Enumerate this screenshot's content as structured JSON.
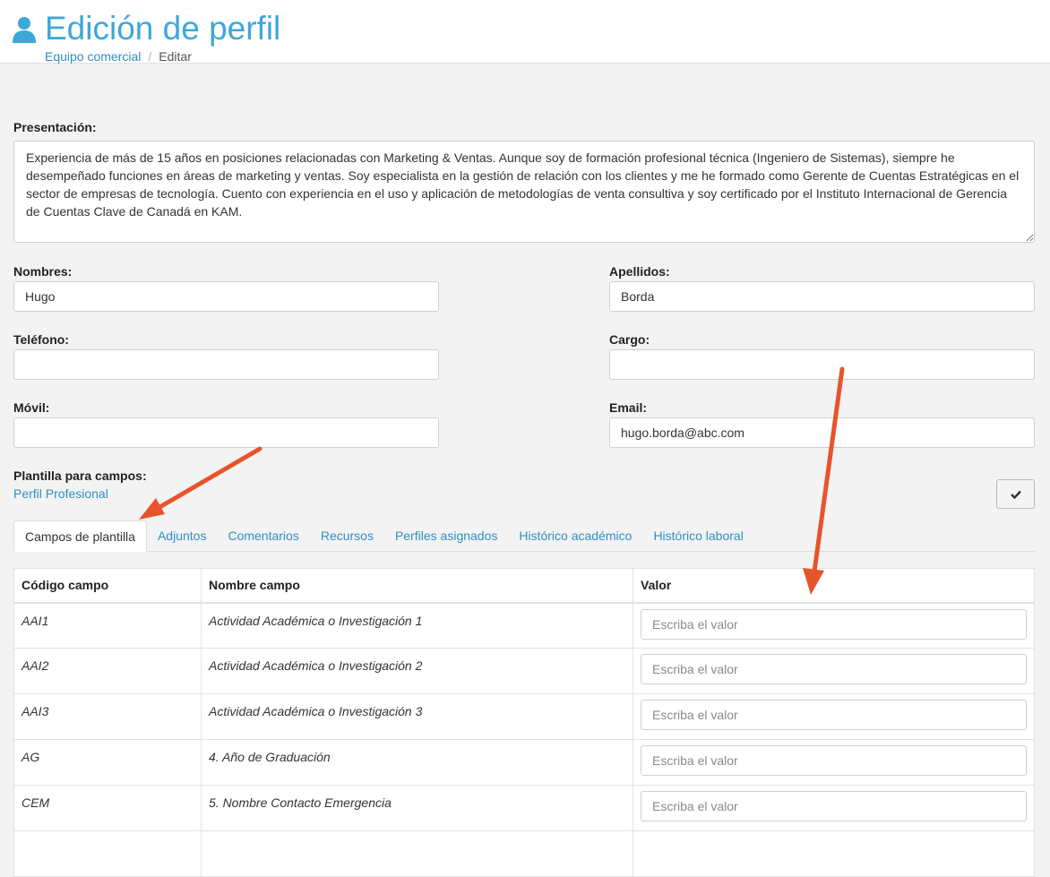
{
  "header": {
    "title": "Edición de perfil",
    "breadcrumb": [
      "Equipo comercial",
      "Editar"
    ]
  },
  "presentation": {
    "label": "Presentación:",
    "text": "Experiencia de más de 15 años en posiciones relacionadas con Marketing & Ventas. Aunque soy de formación profesional técnica (Ingeniero de Sistemas), siempre he desempeñado funciones en áreas de marketing y ventas. Soy especialista en la gestión de relación con los clientes y me he formado como Gerente de Cuentas Estratégicas en el sector de empresas de tecnología. Cuento con experiencia en el uso y aplicación de metodologías de venta consultiva y soy certificado por el Instituto Internacional de Gerencia de Cuentas Clave de Canadá en KAM."
  },
  "fields": {
    "nombres": {
      "label": "Nombres:",
      "value": "Hugo"
    },
    "apellidos": {
      "label": "Apellidos:",
      "value": "Borda"
    },
    "telefono": {
      "label": "Teléfono:",
      "value": ""
    },
    "cargo": {
      "label": "Cargo:",
      "value": ""
    },
    "movil": {
      "label": "Móvil:",
      "value": ""
    },
    "email": {
      "label": "Email:",
      "value": "hugo.borda@abc.com"
    }
  },
  "template": {
    "label": "Plantilla para campos:",
    "value": "Perfil Profesional"
  },
  "tabs": [
    {
      "label": "Campos de plantilla",
      "active": true
    },
    {
      "label": "Adjuntos",
      "active": false
    },
    {
      "label": "Comentarios",
      "active": false
    },
    {
      "label": "Recursos",
      "active": false
    },
    {
      "label": "Perfiles asignados",
      "active": false
    },
    {
      "label": "Histórico académico",
      "active": false
    },
    {
      "label": "Histórico laboral",
      "active": false
    }
  ],
  "table": {
    "columns": [
      "Código campo",
      "Nombre campo",
      "Valor"
    ],
    "placeholder": "Escriba el valor",
    "rows": [
      {
        "code": "AAI1",
        "name": "Actividad Académica o Investigación 1",
        "value": ""
      },
      {
        "code": "AAI2",
        "name": "Actividad Académica o Investigación 2",
        "value": ""
      },
      {
        "code": "AAI3",
        "name": "Actividad Académica o Investigación 3",
        "value": ""
      },
      {
        "code": "AG",
        "name": "4. Año de Graduación",
        "value": ""
      },
      {
        "code": "CEM",
        "name": "5. Nombre Contacto Emergencia",
        "value": ""
      },
      {
        "code": "",
        "name": "",
        "value": ""
      }
    ]
  },
  "colors": {
    "accent": "#3ea7d8",
    "link": "#2f8fc0",
    "annotation_arrow": "#e8542a"
  }
}
